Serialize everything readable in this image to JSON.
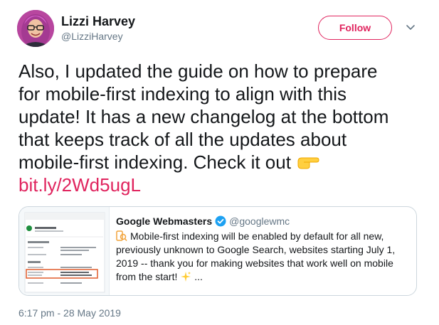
{
  "author": {
    "name": "Lizzi Harvey",
    "handle": "@LizziHarvey",
    "follow_label": "Follow"
  },
  "tweet": {
    "lines": [
      "Also, I updated the guide on how to prepare",
      "for mobile-first indexing to align with this",
      "update! It has a new changelog at the bottom",
      "that keeps track of all the updates about",
      "mobile-first indexing. Check it out"
    ],
    "link": "bit.ly/2Wd5ugL",
    "timestamp": "6:17 pm - 28 May 2019"
  },
  "quoted": {
    "name": "Google Webmasters",
    "handle": "@googlewmc",
    "lines": [
      "Mobile-first indexing will be enabled by default for all new,",
      "previously unknown to Google Search, websites starting July 1,",
      "2019 -- thank you for making websites that work well on mobile",
      "from the start!"
    ],
    "ellipsis": "...",
    "thumbnail": {
      "url": "https://www.example.com/",
      "card_title": "Coverage",
      "rows": [
        "Discovery",
        "Referring page",
        "Crawl",
        "Last crawl",
        "Crawled as",
        "Page fetch"
      ],
      "values": [
        "",
        "None detected",
        "",
        "",
        "Googlebot smartphone",
        "Successful"
      ]
    }
  },
  "colors": {
    "accent": "#e0245e",
    "verified": "#1da1f2",
    "muted": "#657786",
    "border": "#ccd6dd"
  },
  "icons": [
    "avatar",
    "chevron-down-icon",
    "backhand-index-pointing-right-icon",
    "verified-badge-icon",
    "mobile-indexing-icon",
    "sparkles-icon"
  ]
}
